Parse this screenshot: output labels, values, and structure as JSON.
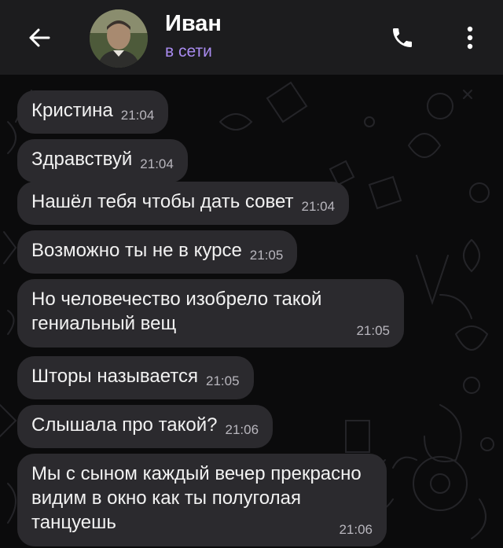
{
  "header": {
    "contact_name": "Иван",
    "status": "в сети",
    "status_color": "#a98bf0",
    "icons": [
      "back-arrow-icon",
      "phone-icon",
      "more-vertical-icon"
    ]
  },
  "messages": [
    {
      "text": "Кристина",
      "time": "21:04"
    },
    {
      "text": "Здравствуй",
      "time": "21:04"
    },
    {
      "text": "Нашёл тебя чтобы дать совет",
      "time": "21:04"
    },
    {
      "text": "Возможно ты не в курсе",
      "time": "21:05"
    },
    {
      "text": "Но человечество изобрело такой гениальный вещ",
      "time": "21:05"
    },
    {
      "text": "Шторы называется",
      "time": "21:05"
    },
    {
      "text": "Слышала про такой?",
      "time": "21:06"
    },
    {
      "text": "Мы с сыном каждый вечер прекрасно видим в окно как ты полуголая танцуешь",
      "time": "21:06"
    }
  ],
  "colors": {
    "header_bg": "#1c1c1e",
    "bubble_bg": "#2b2a2e",
    "chat_bg": "#0b0b0c"
  }
}
